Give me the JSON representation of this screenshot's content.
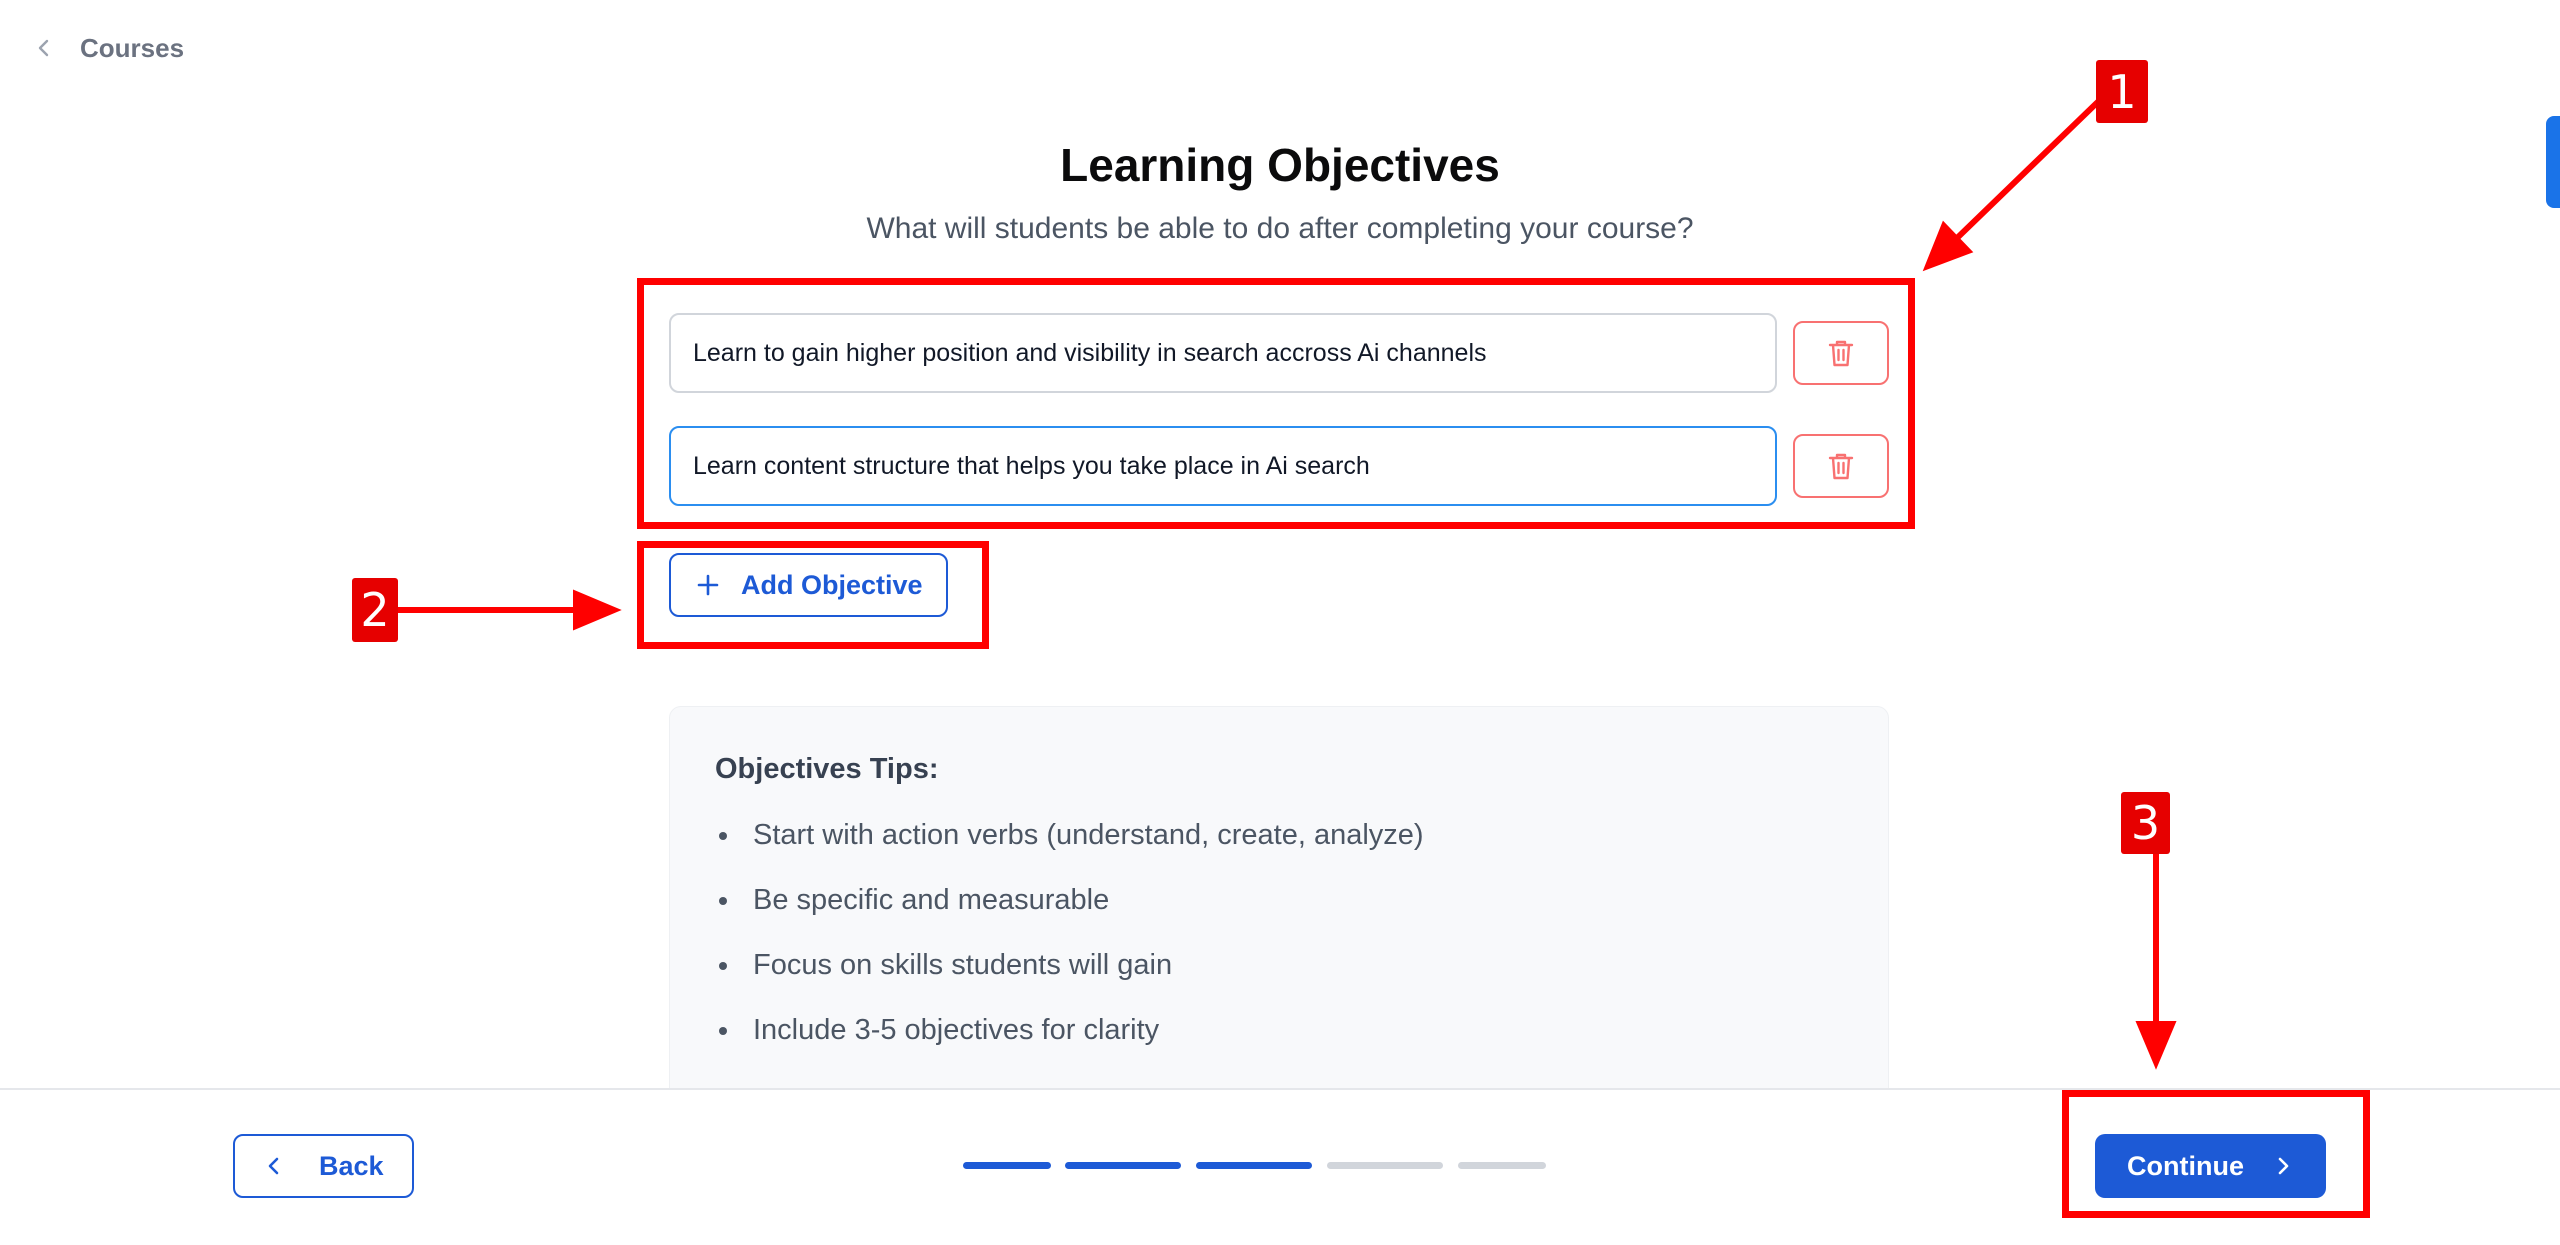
{
  "nav": {
    "back_label": "Courses"
  },
  "header": {
    "title": "Learning Objectives",
    "subtitle": "What will students be able to do after completing your course?"
  },
  "objectives": [
    {
      "value": "Learn to gain higher position and visibility in search accross Ai channels"
    },
    {
      "value": "Learn content structure that helps you take place in Ai search"
    }
  ],
  "add_objective_label": "Add Objective",
  "tips": {
    "title": "Objectives Tips:",
    "items": [
      "Start with action verbs (understand, create, analyze)",
      "Be specific and measurable",
      "Focus on skills students will gain",
      "Include 3-5 objectives for clarity"
    ]
  },
  "footer": {
    "back_label": "Back",
    "continue_label": "Continue",
    "progress": {
      "total_steps": 5,
      "completed_steps": 3
    }
  },
  "annotations": [
    "1",
    "2",
    "3"
  ],
  "colors": {
    "primary": "#1d5ad6",
    "danger": "#f87171",
    "focus": "#2b8ef0",
    "annotation": "#ff0000"
  }
}
